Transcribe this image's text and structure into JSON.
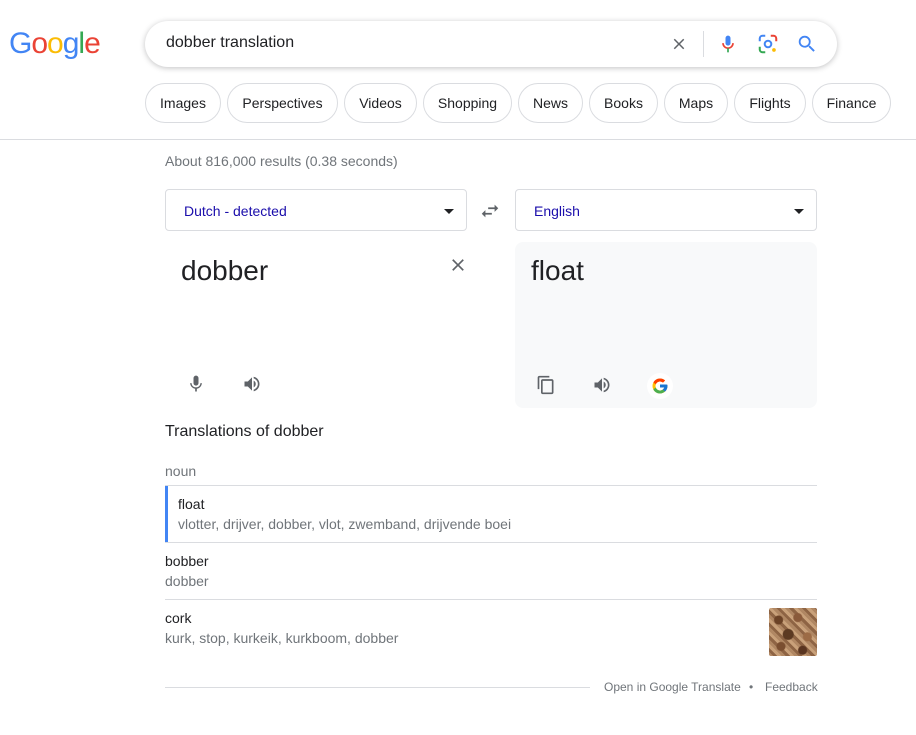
{
  "logo": {
    "letters": [
      "G",
      "o",
      "o",
      "g",
      "l",
      "e"
    ],
    "colors": [
      "#4285F4",
      "#EA4335",
      "#FBBC05",
      "#4285F4",
      "#34A853",
      "#EA4335"
    ]
  },
  "search": {
    "query": "dobber translation",
    "icons": [
      "close-icon",
      "mic-icon",
      "lens-icon",
      "search-icon"
    ]
  },
  "chips": [
    "Images",
    "Perspectives",
    "Videos",
    "Shopping",
    "News",
    "Books",
    "Maps",
    "Flights",
    "Finance"
  ],
  "stats": "About 816,000 results (0.38 seconds)",
  "translator": {
    "source_lang": "Dutch - detected",
    "target_lang": "English",
    "source_text": "dobber",
    "target_text": "float",
    "accent_color": "#1a0dab"
  },
  "translations": {
    "heading": "Translations of dobber",
    "part_of_speech": "noun",
    "entries": [
      {
        "word": "float",
        "synonyms": "vlotter, drijver, dobber, vlot, zwemband, drijvende boei"
      },
      {
        "word": "bobber",
        "synonyms": "dobber"
      },
      {
        "word": "cork",
        "synonyms": "kurk, stop, kurkeik, kurkboom, dobber"
      }
    ]
  },
  "footer": {
    "open_link": "Open in Google Translate",
    "separator": "•",
    "feedback": "Feedback"
  }
}
